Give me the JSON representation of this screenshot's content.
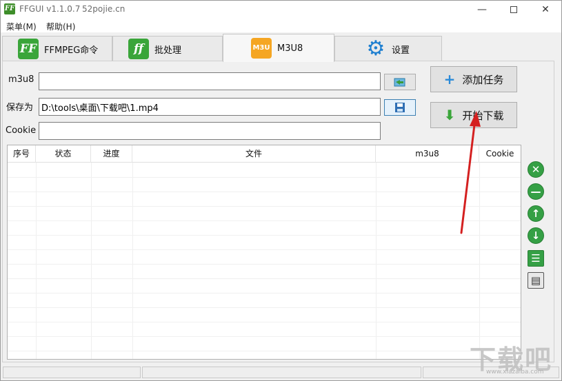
{
  "window": {
    "title": "FFGUI v1.1.0.7",
    "site": "52pojie.cn",
    "app_icon_text": "FF",
    "minimize": "—",
    "close": "✕"
  },
  "menu": {
    "items": [
      "菜单(M)",
      "帮助(H)"
    ]
  },
  "tabs": [
    {
      "label": "FFMPEG命令",
      "icon": "ff-logo-icon",
      "icon_text": "FF",
      "color": "#3aa53a"
    },
    {
      "label": "批处理",
      "icon": "ff-italic-icon",
      "icon_text": "ff",
      "color": "#3aa53a"
    },
    {
      "label": "M3U8",
      "icon": "m3u-icon",
      "icon_text": "M3U",
      "color": "#f5a623",
      "active": true
    },
    {
      "label": "设置",
      "icon": "gear-icon",
      "icon_text": "⚙",
      "color": "#1e7fd0"
    }
  ],
  "form": {
    "m3u8_label": "m3u8",
    "m3u8_value": "",
    "save_label": "保存为",
    "save_value": "D:\\tools\\桌面\\下载吧\\1.mp4",
    "cookie_label": "Cookie",
    "cookie_value": ""
  },
  "buttons": {
    "add_task": "添加任务",
    "add_icon": "+",
    "start_download": "开始下载",
    "download_icon": "⬇"
  },
  "table": {
    "columns": [
      "序号",
      "状态",
      "进度",
      "文件",
      "m3u8",
      "Cookie"
    ],
    "rows": []
  },
  "side_controls": [
    {
      "name": "delete-icon",
      "glyph": "✕"
    },
    {
      "name": "remove-icon",
      "glyph": "—"
    },
    {
      "name": "move-up-icon",
      "glyph": "↑"
    },
    {
      "name": "move-down-icon",
      "glyph": "↓"
    },
    {
      "name": "list-icon",
      "glyph": "☰"
    },
    {
      "name": "notebook-icon",
      "glyph": "▤"
    }
  ],
  "colors": {
    "accent_green": "#35a045",
    "annotation_red": "#d42020"
  },
  "watermark": {
    "main": "下载吧",
    "sub": "www.xiazaiba.com"
  }
}
